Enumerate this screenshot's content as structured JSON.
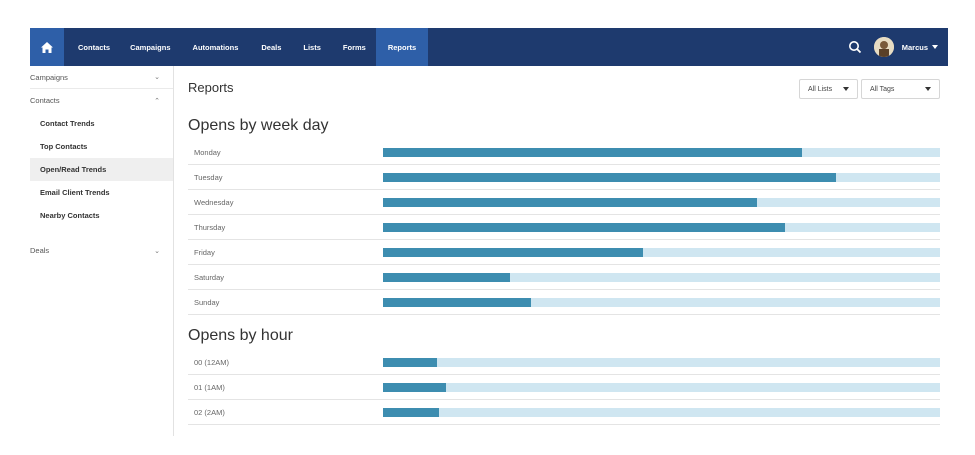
{
  "nav": {
    "items": [
      {
        "label": "Contacts",
        "active": false
      },
      {
        "label": "Campaigns",
        "active": false
      },
      {
        "label": "Automations",
        "active": false
      },
      {
        "label": "Deals",
        "active": false
      },
      {
        "label": "Lists",
        "active": false
      },
      {
        "label": "Forms",
        "active": false
      },
      {
        "label": "Reports",
        "active": true
      }
    ],
    "user": "Marcus"
  },
  "sidebar": {
    "groups": [
      {
        "label": "Campaigns",
        "chevron": "⌄"
      },
      {
        "label": "Contacts",
        "chevron": "⌃"
      },
      {
        "label": "Deals",
        "chevron": "⌄"
      }
    ],
    "items": [
      {
        "label": "Contact Trends",
        "active": false
      },
      {
        "label": "Top Contacts",
        "active": false
      },
      {
        "label": "Open/Read Trends",
        "active": true
      },
      {
        "label": "Email Client Trends",
        "active": false
      },
      {
        "label": "Nearby Contacts",
        "active": false
      }
    ]
  },
  "main": {
    "title": "Reports",
    "filters": {
      "lists": "All Lists",
      "tags": "All Tags"
    },
    "weekday_title": "Opens by week day",
    "hour_title": "Opens by hour"
  },
  "weekday": [
    {
      "label": "Monday",
      "value": 0.752
    },
    {
      "label": "Tuesday",
      "value": 0.814
    },
    {
      "label": "Wednesday",
      "value": 0.671
    },
    {
      "label": "Thursday",
      "value": 0.722
    },
    {
      "label": "Friday",
      "value": 0.467
    },
    {
      "label": "Saturday",
      "value": 0.228
    },
    {
      "label": "Sunday",
      "value": 0.266
    }
  ],
  "hour": [
    {
      "label": "00 (12AM)",
      "value": 0.097
    },
    {
      "label": "01 (1AM)",
      "value": 0.113
    },
    {
      "label": "02 (2AM)",
      "value": 0.1
    }
  ],
  "colors": {
    "nav": "#1e3a6e",
    "nav_active": "#2e5fa8",
    "bar": "#3d8db0",
    "track": "#cfe6f1"
  },
  "icons": {
    "home": "home-icon",
    "search": "search-icon"
  }
}
